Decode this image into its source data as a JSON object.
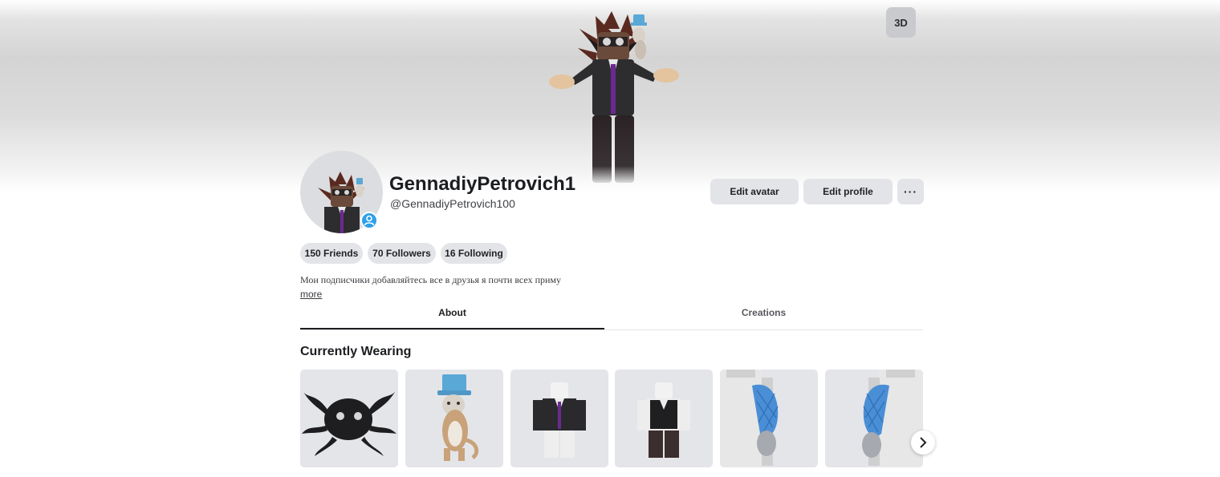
{
  "banner": {
    "view_toggle": "3D"
  },
  "profile": {
    "display_name": "GennadiyPetrovich1",
    "username": "@GennadiyPetrovich100",
    "bio": "Мои подписчики добавляйтесь все в друзья я почти всех приму",
    "more_link": "more",
    "online_status_icon": "user-icon"
  },
  "actions": {
    "edit_avatar": "Edit avatar",
    "edit_profile": "Edit profile",
    "more_options": "···"
  },
  "stats": {
    "friends": "150 Friends",
    "followers": "70 Followers",
    "following": "16 Following"
  },
  "tabs": [
    {
      "label": "About",
      "active": true
    },
    {
      "label": "Creations",
      "active": false
    }
  ],
  "currently_wearing": {
    "title": "Currently Wearing",
    "items": [
      {
        "icon": "black-tentacle-head-mask-icon"
      },
      {
        "icon": "cat-with-blue-top-hat-icon"
      },
      {
        "icon": "black-suit-purple-tie-shirt-icon"
      },
      {
        "icon": "black-vest-shirt-icon"
      },
      {
        "icon": "blue-checkered-left-arm-icon"
      },
      {
        "icon": "blue-checkered-right-arm-icon"
      }
    ],
    "next_icon": "chevron-right-icon"
  }
}
